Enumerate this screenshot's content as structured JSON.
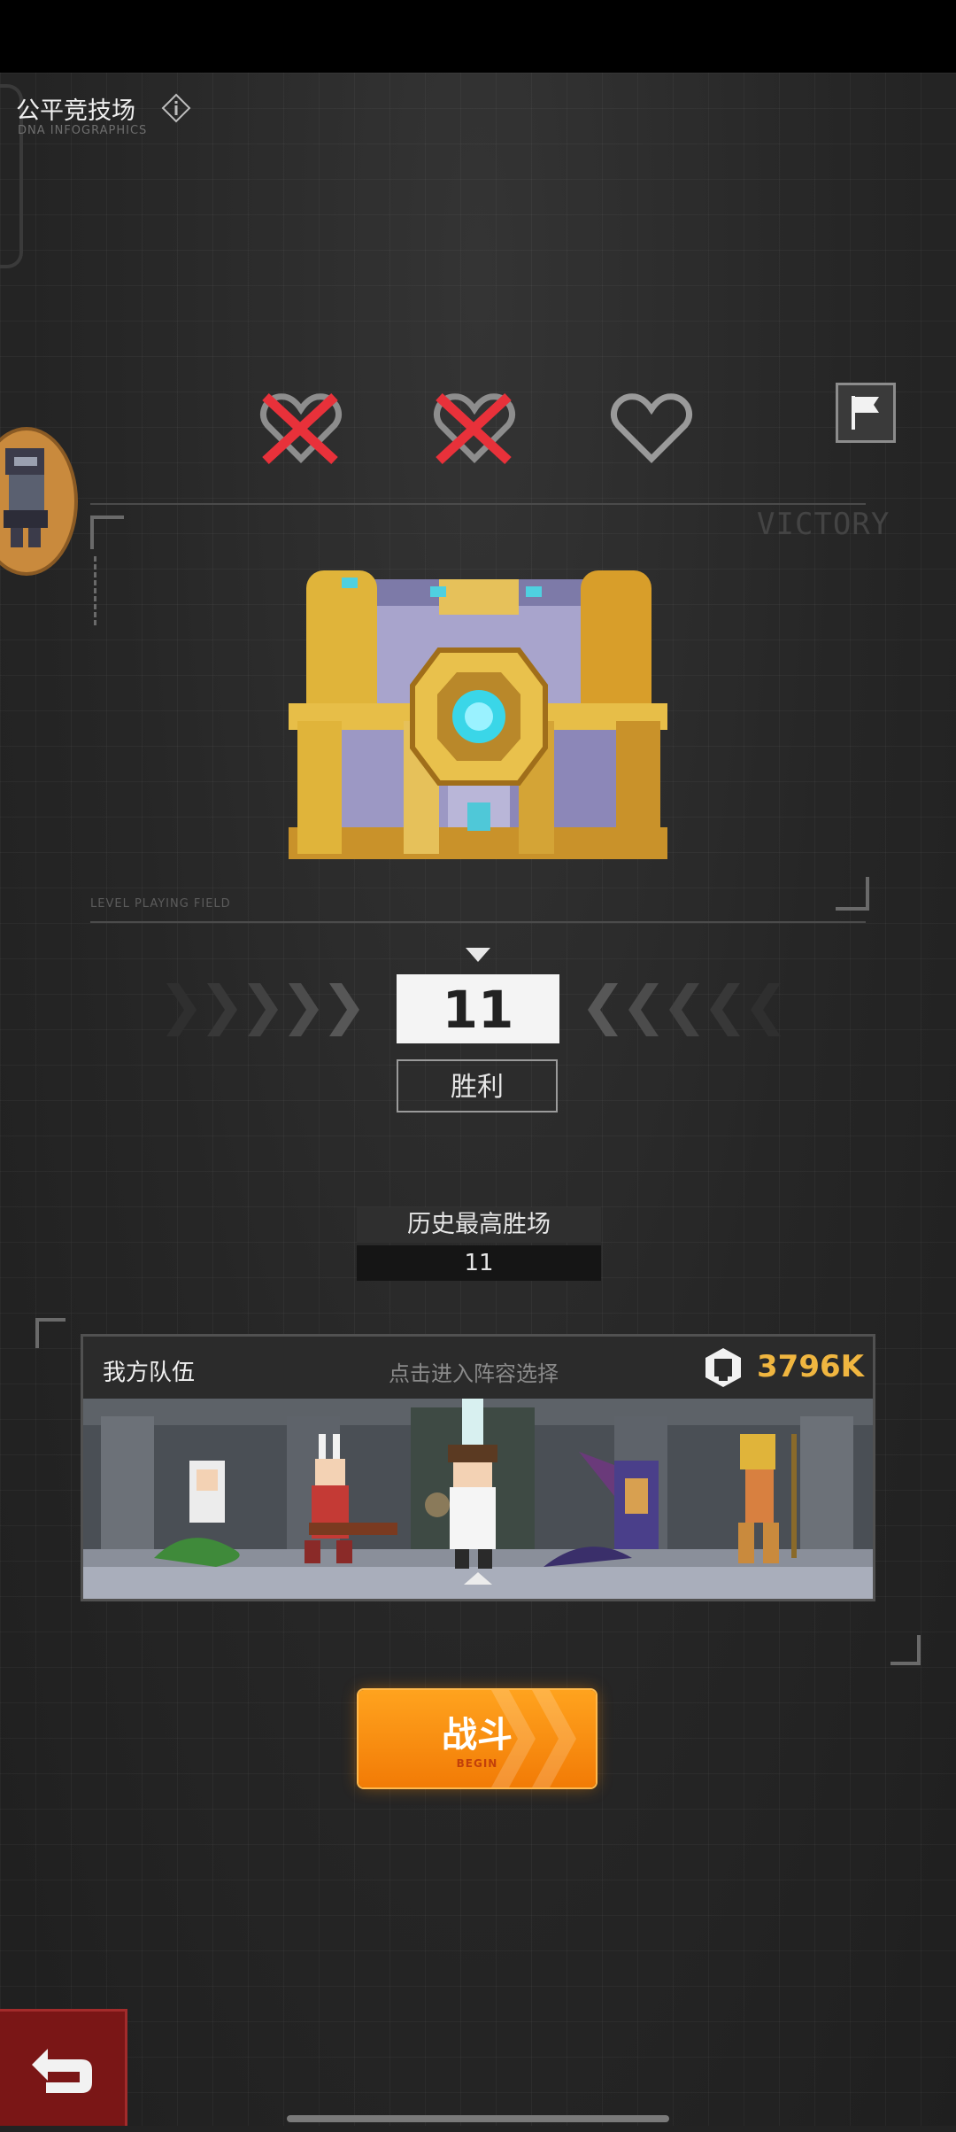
{
  "header": {
    "title": "公平竞技场",
    "subtitle": "DNA INFOGRAPHICS",
    "info_icon": "info-icon"
  },
  "lives": {
    "lost": 2,
    "remaining": 1,
    "total": 3,
    "icons": [
      "heart-lost-icon",
      "heart-lost-icon",
      "heart-outline-icon"
    ],
    "lost_color": "#e8313a"
  },
  "surrender_icon": "flag-icon",
  "reward_panel": {
    "victory_text": "VICTORY",
    "field_text": "LEVEL PLAYING FIELD",
    "chest_icon": "treasure-chest-icon"
  },
  "wins": {
    "count": "11",
    "label": "胜利"
  },
  "history": {
    "label": "历史最高胜场",
    "value": "11"
  },
  "team": {
    "title": "我方队伍",
    "hint": "点击进入阵容选择",
    "power": "3796K",
    "power_icon": "fist-icon",
    "accent_color": "#f0b640"
  },
  "fight_button": {
    "label": "战斗",
    "sub": "BEGIN",
    "color": "#f58a0c"
  },
  "back_icon": "back-arrow-icon"
}
